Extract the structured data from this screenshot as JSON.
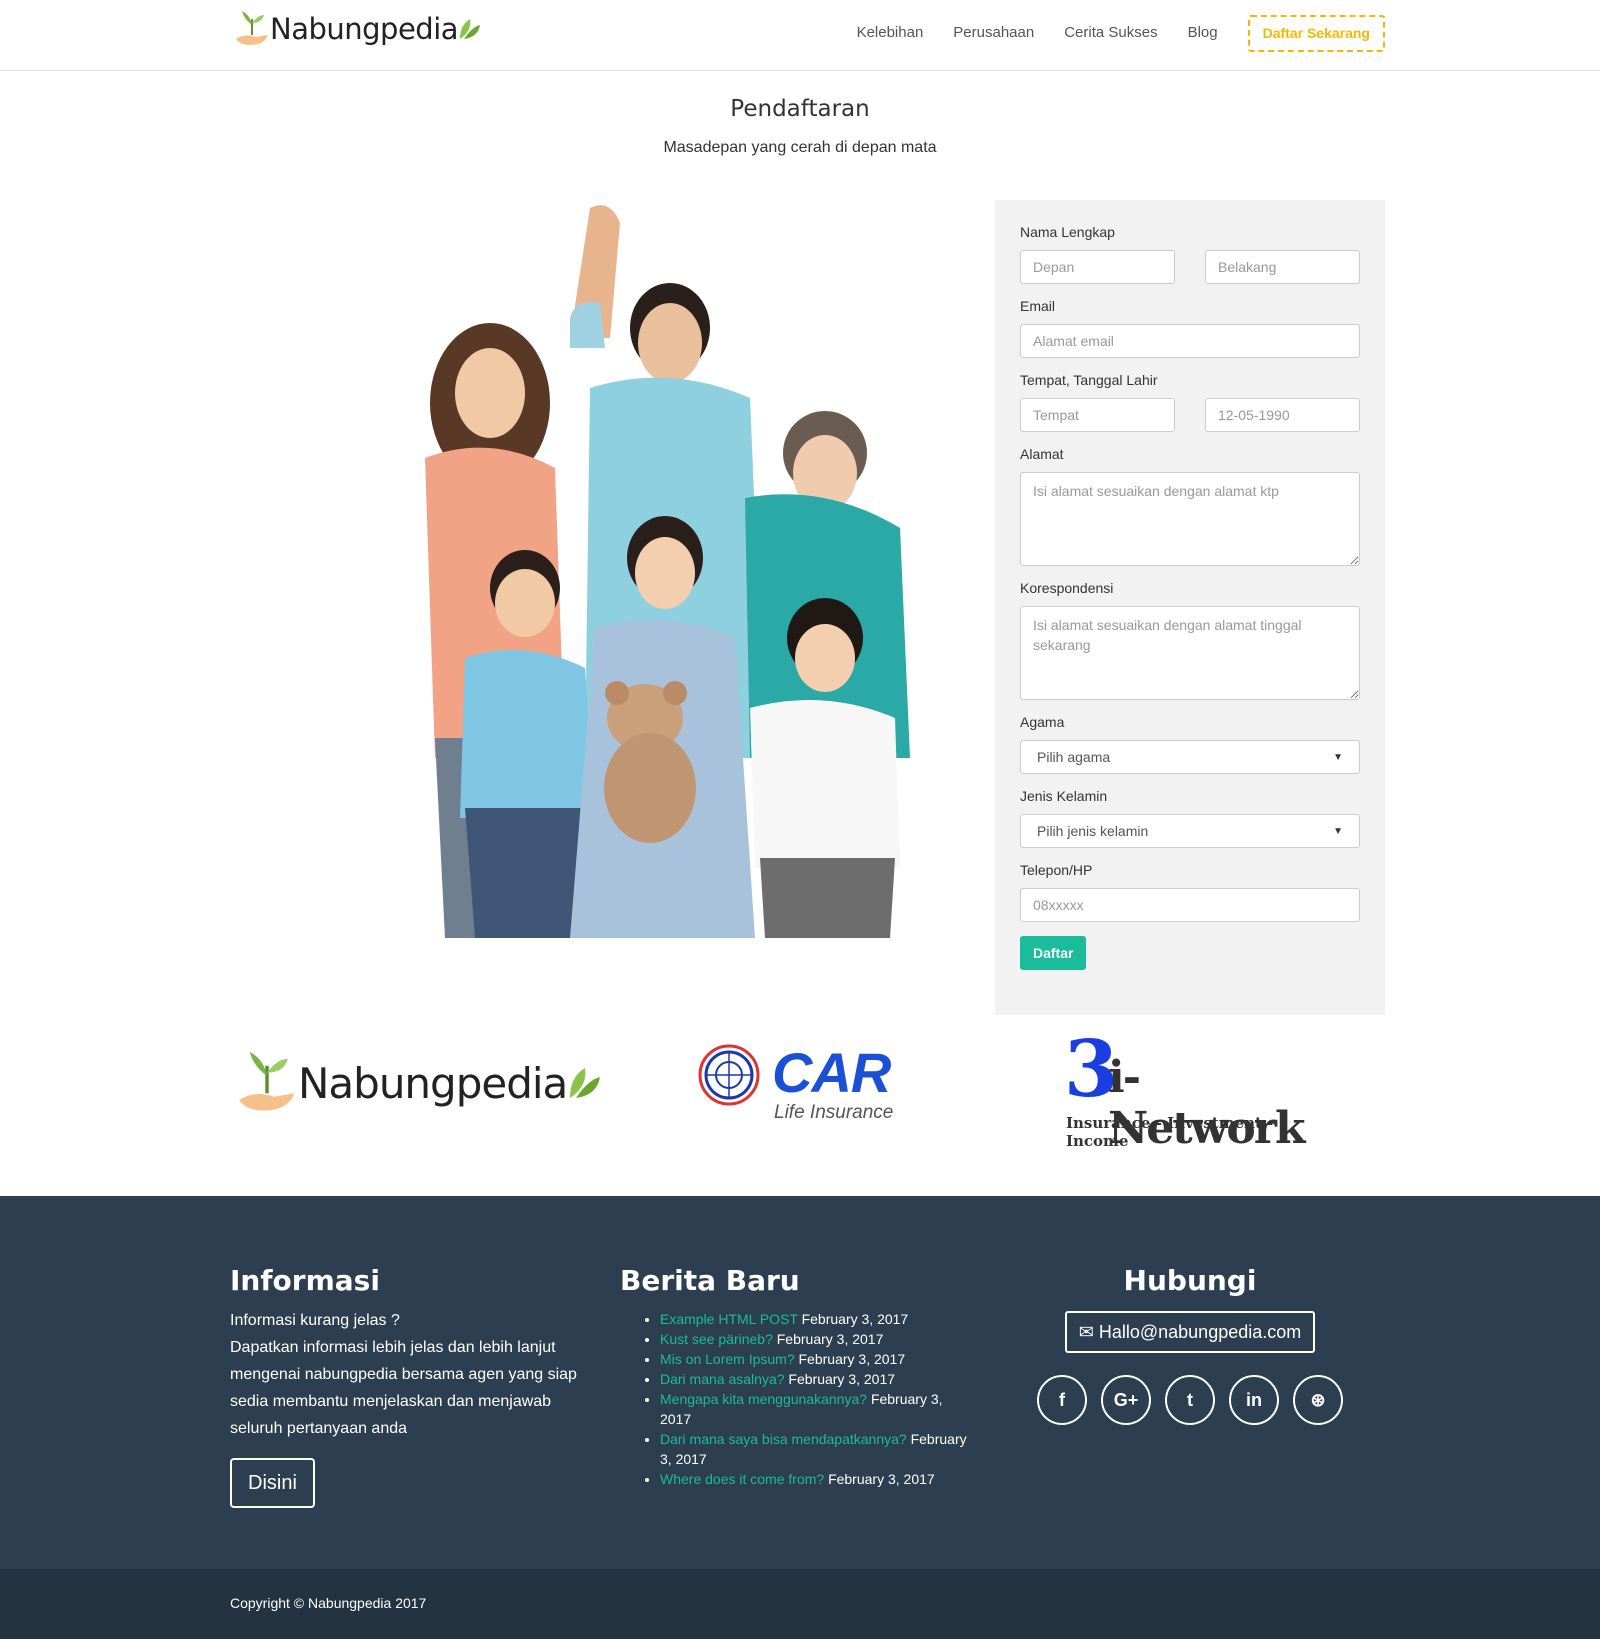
{
  "brand": {
    "name": "Nabungpedia"
  },
  "nav": {
    "links": [
      "Kelebihan",
      "Perusahaan",
      "Cerita Sukses",
      "Blog"
    ],
    "cta": "Daftar Sekarang"
  },
  "heading": {
    "title": "Pendaftaran",
    "subtitle": "Masadepan yang cerah di depan mata"
  },
  "form": {
    "name_label": "Nama Lengkap",
    "first_placeholder": "Depan",
    "last_placeholder": "Belakang",
    "email_label": "Email",
    "email_placeholder": "Alamat email",
    "birth_label": "Tempat, Tanggal Lahir",
    "place_placeholder": "Tempat",
    "date_placeholder": "12-05-1990",
    "address_label": "Alamat",
    "address_placeholder": "Isi alamat sesuaikan dengan alamat ktp",
    "corr_label": "Korespondensi",
    "corr_placeholder": "Isi alamat sesuaikan dengan alamat tinggal sekarang",
    "religion_label": "Agama",
    "religion_value": "Pilih agama",
    "gender_label": "Jenis Kelamin",
    "gender_value": "Pilih jenis kelamin",
    "phone_label": "Telepon/HP",
    "phone_placeholder": "08xxxxx",
    "submit": "Daftar"
  },
  "partners": {
    "nabung": "Nabungpedia",
    "car_main": "CAR",
    "car_sub": "Life Insurance",
    "network_num": "3",
    "network_main": "i-Network",
    "network_sub": "Insurance - Investment - Income"
  },
  "footer": {
    "info_title": "Informasi",
    "info_q": "Informasi kurang jelas ?",
    "info_text": "Dapatkan informasi lebih jelas dan lebih lanjut mengenai nabungpedia bersama agen yang siap sedia membantu menjelaskan dan menjawab seluruh pertanyaan anda",
    "info_button": "Disini",
    "news_title": "Berita Baru",
    "news": [
      {
        "title": "Example HTML POST",
        "date": "February 3, 2017"
      },
      {
        "title": "Kust see pärineb?",
        "date": "February 3, 2017"
      },
      {
        "title": "Mis on Lorem Ipsum?",
        "date": "February 3, 2017"
      },
      {
        "title": "Dari mana asalnya?",
        "date": "February 3, 2017"
      },
      {
        "title": "Mengapa kita menggunakannya?",
        "date": "February 3, 2017"
      },
      {
        "title": "Dari mana saya bisa mendapatkannya?",
        "date": "February 3, 2017"
      },
      {
        "title": "Where does it come from?",
        "date": "February 3, 2017"
      }
    ],
    "contact_title": "Hubungi",
    "email": "Hallo@nabungpedia.com",
    "socials": [
      "f",
      "G+",
      "t",
      "in",
      "⊛"
    ]
  },
  "copyright": "Copyright © Nabungpedia 2017",
  "colors": {
    "accent": "#1abc9c",
    "cta": "#f5b800",
    "footer": "#2c3e50",
    "bottom": "#243342"
  }
}
